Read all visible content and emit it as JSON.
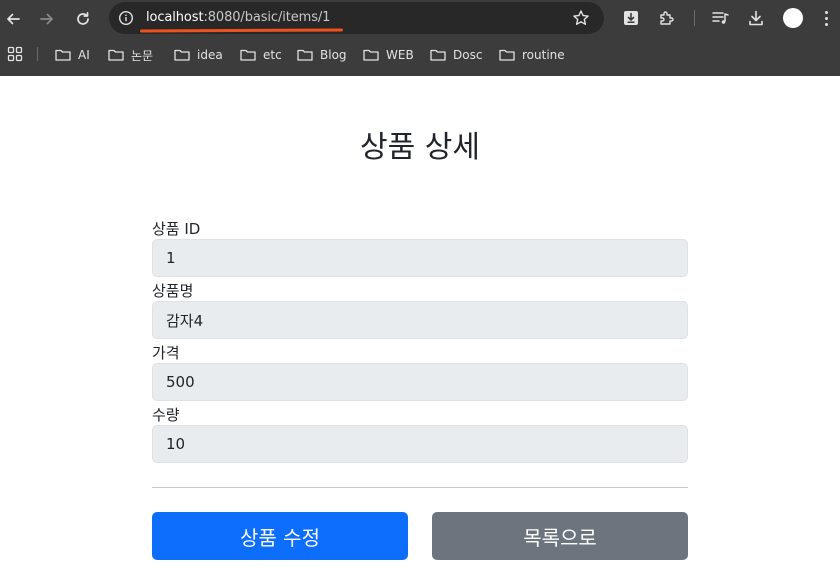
{
  "browser": {
    "url_host": "localhost",
    "url_path": ":8080/basic/items/1",
    "bookmarks": [
      {
        "label": "AI"
      },
      {
        "label": "논문"
      },
      {
        "label": "idea"
      },
      {
        "label": "etc"
      },
      {
        "label": "Blog"
      },
      {
        "label": "WEB"
      },
      {
        "label": "Dosc"
      },
      {
        "label": "routine"
      }
    ],
    "colors": {
      "chrome_bg": "#3c3c3c",
      "omnibox_bg": "#282828",
      "url_underline": "#f0521e"
    }
  },
  "page": {
    "title": "상품 상세",
    "fields": [
      {
        "label": "상품 ID",
        "value": "1"
      },
      {
        "label": "상품명",
        "value": "감자4"
      },
      {
        "label": "가격",
        "value": "500"
      },
      {
        "label": "수량",
        "value": "10"
      }
    ],
    "buttons": {
      "edit": "상품 수정",
      "list": "목록으로"
    },
    "colors": {
      "primary": "#0d6efd",
      "secondary": "#6c757d",
      "readonly_field": "#e9ecef"
    }
  }
}
